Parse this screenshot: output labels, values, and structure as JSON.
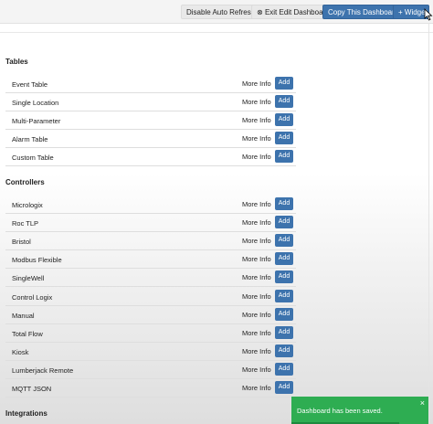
{
  "toolbar": {
    "disable_auto_refresh": "Disable Auto Refresh",
    "exit_edit_dashboard": "Exit Edit Dashboard",
    "exit_icon_glyph": "⊗",
    "copy_dashboard": "Copy This Dashboard",
    "add_widget": "+ Widget"
  },
  "sections": {
    "tables": {
      "title": "Tables",
      "items": [
        "Event Table",
        "Single Location",
        "Multi-Parameter",
        "Alarm Table",
        "Custom Table"
      ]
    },
    "controllers": {
      "title": "Controllers",
      "items": [
        "Micrologix",
        "Roc TLP",
        "Bristol",
        "Modbus Flexible",
        "SingleWell",
        "Control Logix",
        "Manual",
        "Total Flow",
        "Kiosk",
        "Lumberjack Remote",
        "MQTT JSON"
      ]
    },
    "integrations": {
      "title": "Integrations"
    }
  },
  "row_actions": {
    "more_info": "More Info",
    "add": "Add"
  },
  "toast": {
    "message": "Dashboard has been saved.",
    "close": "×"
  },
  "colors": {
    "primary_blue": "#3d73ad",
    "toast_green": "#2ead52"
  }
}
